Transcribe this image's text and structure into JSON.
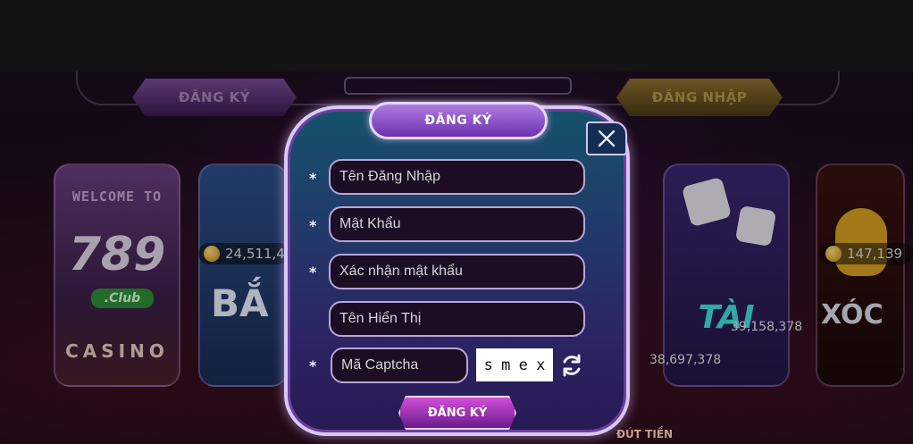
{
  "background": {
    "top_buttons": {
      "register_label": "ĐĂNG KÝ",
      "login_label": "ĐĂNG NHẬP"
    },
    "cards": {
      "casino": {
        "welcome": "WELCOME TO",
        "logo": "789",
        "club": ".Club",
        "casino": "CASINO"
      },
      "shark": {
        "title": "BẮ",
        "jackpot": "24,511,4"
      },
      "taixiu": {
        "title": "TÀI",
        "amount_a": "38,697,378",
        "amount_b": "39,158,378"
      },
      "xoc": {
        "title": "XÓC",
        "jackpot": "147,139"
      }
    },
    "bottom_text": "ĐÚT TIỀN"
  },
  "modal": {
    "title": "ĐĂNG KÝ",
    "close_label": "X",
    "required_mark": "*",
    "fields": {
      "username": {
        "placeholder": "Tên Đăng Nhập"
      },
      "password": {
        "placeholder": "Mật Khẩu"
      },
      "confirm_password": {
        "placeholder": "Xác nhận mật khẩu"
      },
      "display_name": {
        "placeholder": "Tên Hiển Thị"
      },
      "captcha": {
        "placeholder": "Mã Captcha"
      }
    },
    "captcha_chars": [
      "s",
      "m",
      "e",
      "x"
    ],
    "submit_label": "ĐĂNG KÝ"
  },
  "icons": {
    "close": "close-icon",
    "refresh": "refresh-icon",
    "coin": "coin-icon"
  },
  "colors": {
    "modal_border": "#d9c8f4",
    "title_purple": "#8a4cd0",
    "submit_pink": "#d14fd8"
  }
}
